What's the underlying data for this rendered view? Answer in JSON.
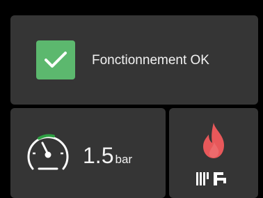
{
  "status": {
    "icon": "check-icon",
    "text": "Fonctionnement OK",
    "color": "#5cb86e"
  },
  "pressure": {
    "icon": "pressure-gauge-icon",
    "value": "1.5",
    "unit": "bar",
    "gauge_color": "#2ea043"
  },
  "mode": {
    "flame_icon": "flame-icon",
    "flame_color": "#e8585a",
    "secondary_icon": "radiator-tap-icon"
  },
  "colors": {
    "background": "#000000",
    "tile": "#353535",
    "text": "#f2f2f2"
  }
}
